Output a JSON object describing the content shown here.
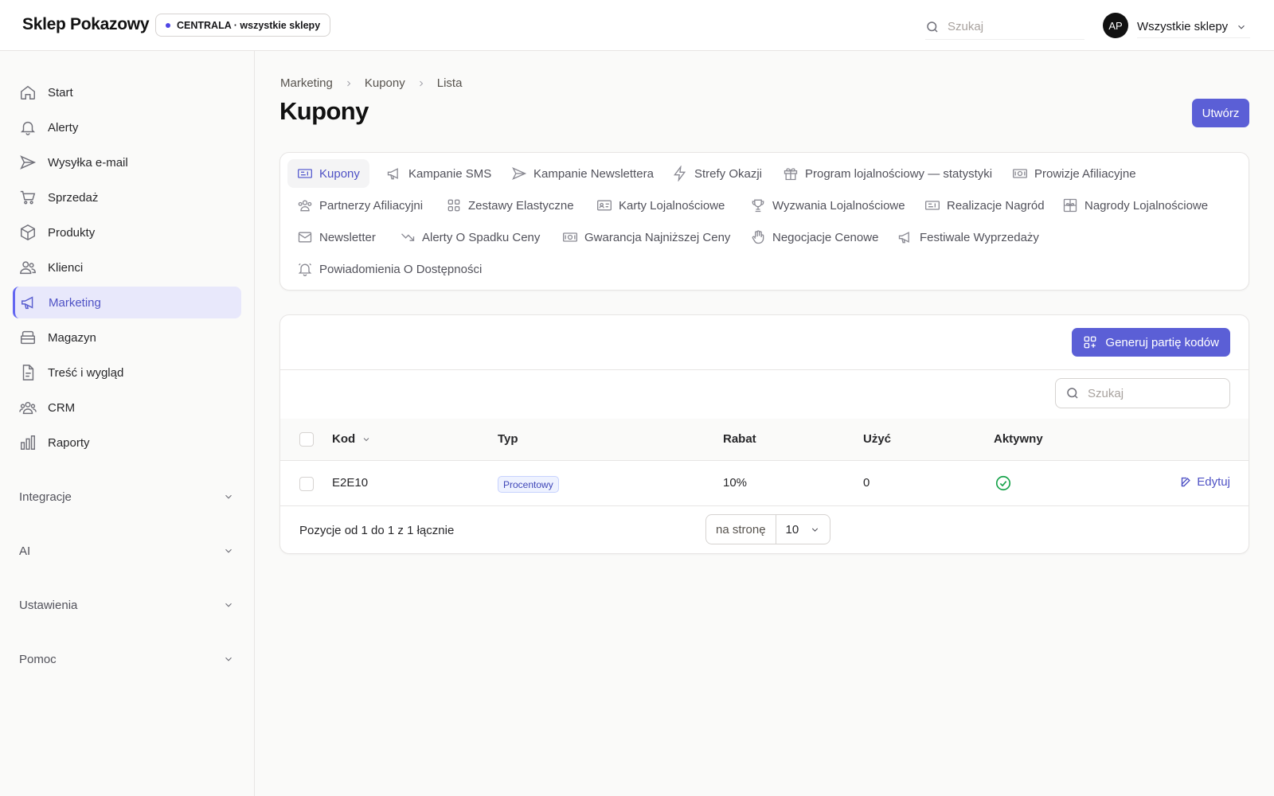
{
  "header": {
    "brand": "Sklep Pokazowy",
    "store_badge": "CENTRALA · wszystkie sklepy",
    "search_placeholder": "Szukaj",
    "avatar_initials": "AP",
    "store_select": "Wszystkie sklepy"
  },
  "sidebar": {
    "items": [
      {
        "label": "Start",
        "icon": "home-icon"
      },
      {
        "label": "Alerty",
        "icon": "bell-icon"
      },
      {
        "label": "Wysyłka e-mail",
        "icon": "send-icon"
      },
      {
        "label": "Sprzedaż",
        "icon": "cart-icon"
      },
      {
        "label": "Produkty",
        "icon": "box-icon"
      },
      {
        "label": "Klienci",
        "icon": "users-icon"
      },
      {
        "label": "Marketing",
        "icon": "megaphone-icon",
        "active": true
      },
      {
        "label": "Magazyn",
        "icon": "archive-icon"
      },
      {
        "label": "Treść i wygląd",
        "icon": "document-icon"
      },
      {
        "label": "CRM",
        "icon": "group-icon"
      },
      {
        "label": "Raporty",
        "icon": "bar-chart-icon"
      }
    ],
    "groups": [
      "Integracje",
      "AI",
      "Ustawienia",
      "Pomoc"
    ]
  },
  "breadcrumb": [
    "Marketing",
    "Kupony",
    "Lista"
  ],
  "page": {
    "title": "Kupony",
    "create_button": "Utwórz"
  },
  "tabs": [
    {
      "label": "Kupony",
      "icon": "ticket-icon",
      "active": true
    },
    {
      "label": "Kampanie SMS",
      "icon": "megaphone-icon"
    },
    {
      "label": "Kampanie Newslettera",
      "icon": "send-icon"
    },
    {
      "label": "Strefy Okazji",
      "icon": "bolt-icon"
    },
    {
      "label": "Program lojalnościowy — statystyki",
      "icon": "gift-icon"
    },
    {
      "label": "Prowizje Afiliacyjne",
      "icon": "banknote-icon"
    },
    {
      "label": "Partnerzy Afiliacyjni",
      "icon": "users-icon"
    },
    {
      "label": "Zestawy Elastyczne",
      "icon": "grid-icon"
    },
    {
      "label": "Karty Lojalnościowe",
      "icon": "id-card-icon"
    },
    {
      "label": "Wyzwania Lojalnościowe",
      "icon": "trophy-icon"
    },
    {
      "label": "Realizacje Nagród",
      "icon": "ticket-icon"
    },
    {
      "label": "Nagrody Lojalnościowe",
      "icon": "gift-box-icon"
    },
    {
      "label": "Newsletter",
      "icon": "mail-icon"
    },
    {
      "label": "Alerty O Spadku Ceny",
      "icon": "trend-down-icon"
    },
    {
      "label": "Gwarancja Najniższej Ceny",
      "icon": "banknote-icon"
    },
    {
      "label": "Negocjacje Cenowe",
      "icon": "hand-icon"
    },
    {
      "label": "Festiwale Wyprzedaży",
      "icon": "megaphone-icon"
    },
    {
      "label": "Powiadomienia O Dostępności",
      "icon": "bell-ring-icon"
    }
  ],
  "list": {
    "generate_button": "Generuj partię kodów",
    "search_placeholder": "Szukaj",
    "columns": {
      "code": "Kod",
      "type": "Typ",
      "discount": "Rabat",
      "uses": "Użyć",
      "active": "Aktywny"
    },
    "rows": [
      {
        "code": "E2E10",
        "type": "Procentowy",
        "discount": "10%",
        "uses": "0",
        "active": true,
        "edit_label": "Edytuj"
      }
    ],
    "footer": "Pozycje od 1 do 1 z 1 łącznie",
    "per_page_label": "na stronę",
    "per_page_value": "10"
  },
  "colors": {
    "accent": "#5b5fd6",
    "active_bg": "#e8e8fb",
    "success": "#16a34a"
  }
}
